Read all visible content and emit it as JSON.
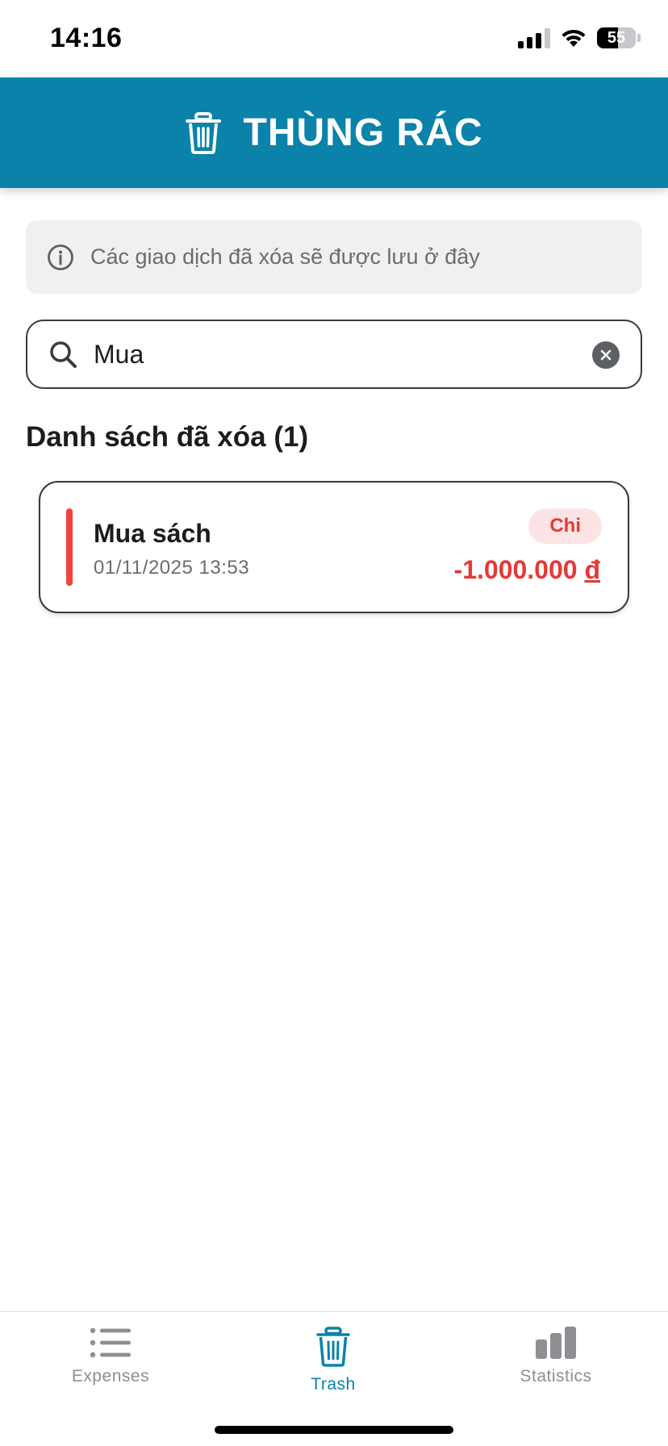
{
  "status_bar": {
    "time": "14:16",
    "battery_level": "55",
    "battery_fraction": 0.55,
    "icons": [
      "cellular-signal-icon",
      "wifi-icon",
      "battery-icon"
    ]
  },
  "header": {
    "title": "THÙNG RÁC",
    "icon": "trash-icon",
    "background_color": "#0a82aa"
  },
  "info_banner": {
    "icon": "info-icon",
    "text": "Các giao dịch đã xóa sẽ được lưu ở đây"
  },
  "search": {
    "icon": "search-icon",
    "value": "Mua",
    "clear_icon": "clear-icon"
  },
  "list": {
    "title": "Danh sách đã xóa (1)",
    "items": [
      {
        "title": "Mua sách",
        "datetime": "01/11/2025 13:53",
        "type_label": "Chi",
        "amount": "-1.000.000",
        "currency": "đ",
        "accent_color": "#f4433c"
      }
    ]
  },
  "tab_bar": {
    "active_tab": "Trash",
    "active_color": "#0a82aa",
    "tabs": [
      {
        "label": "Expenses",
        "icon": "list-icon"
      },
      {
        "label": "Trash",
        "icon": "trash-icon"
      },
      {
        "label": "Statistics",
        "icon": "bar-chart-icon"
      }
    ]
  }
}
